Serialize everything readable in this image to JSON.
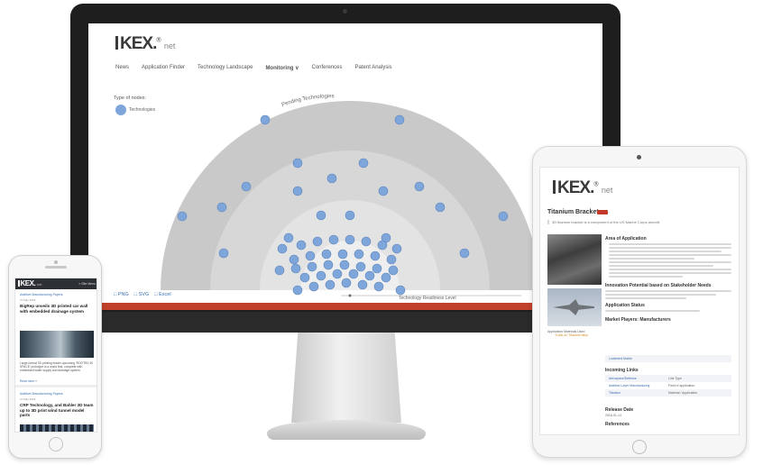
{
  "brand": {
    "logo": "KEX",
    "dot": ".",
    "registered": "®",
    "suffix": "net"
  },
  "desktop": {
    "nav": [
      {
        "label": "News"
      },
      {
        "label": "Application Finder"
      },
      {
        "label": "Technology Landscape"
      },
      {
        "label": "Monitoring ∨"
      },
      {
        "label": "Conferences"
      },
      {
        "label": "Patent Analysis"
      }
    ],
    "legend": {
      "title": "Type of nodes:",
      "item": "Technologies"
    },
    "radar": {
      "arc_label": "Pending Technologies",
      "axis_label": "Technology Readiness Level",
      "ring_colors": [
        "#c9c9c9",
        "#d7d7d7",
        "#e3e3e3",
        "#eeeeee"
      ],
      "node_color": "#7ea6da"
    },
    "exports": [
      {
        "label": "PNG"
      },
      {
        "label": "SVG"
      },
      {
        "label": "Excel"
      }
    ],
    "footer_color": "#c0402a"
  },
  "tablet": {
    "title": "Titanium Bracket",
    "subtitle": "3D titanium bracket is a component of the US Marine Corps aircraft.",
    "sections": {
      "area": "Area of Application",
      "innovation": "Innovation Potential based on Stakeholder Needs",
      "status": "Application Status",
      "market": "Market Players: Manufacturers",
      "links": "Incoming Links",
      "release": "Release Date",
      "release_value": "2016-01-14",
      "references": "References"
    },
    "aside": {
      "label": "Application Materials Used",
      "link": "Ti-6Al-4V Titanium alloy"
    },
    "manufacturer_link": "Lockheed Martin",
    "links_table": [
      {
        "left": "Aerospace/Defense",
        "right": "Link Type"
      },
      {
        "left": "Additive Layer Manufacturing",
        "right": "Field of application"
      },
      {
        "left": "Titanium",
        "right": "Material / Application"
      }
    ]
  },
  "phone": {
    "menu": "≡ Site Menu",
    "article1": {
      "category": "Additive Manufacturing Papers",
      "date": "27 May 2016",
      "headline": "BigRep unveils 3D printed car wall with embedded drainage system",
      "excerpt": "Large-format 3D printing leader upcoming 'ROOTED IN SPACE' prototype is a world first, complete with embedded water supply and drainage system.",
      "more": "Read more »"
    },
    "article2": {
      "category": "Additive Manufacturing Papers",
      "date": "27 May 2016",
      "headline": "CRP Technology, and Bahler 3D team up to 3D print wind tunnel model parts"
    }
  }
}
